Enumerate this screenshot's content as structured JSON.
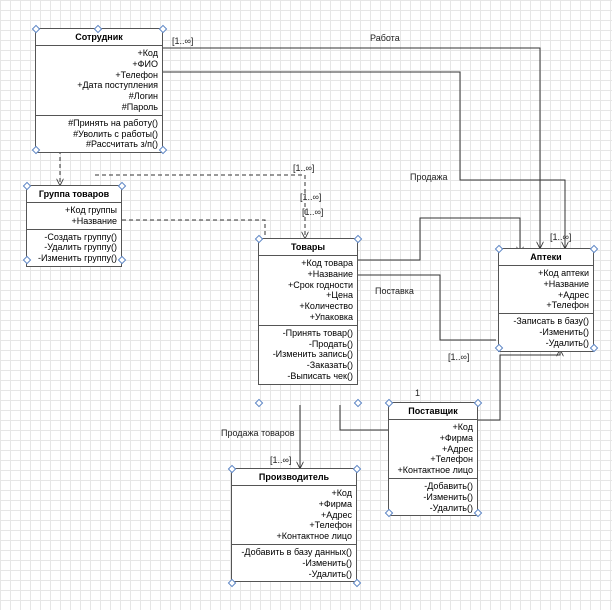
{
  "classes": {
    "employee": {
      "title": "Сотрудник",
      "attrs": [
        "+Код",
        "+ФИО",
        "+Телефон",
        "+Дата поступления",
        "#Логин",
        "#Пароль"
      ],
      "ops": [
        "#Принять на работу()",
        "#Уволить с работы()",
        "#Рассчитать з/п()"
      ]
    },
    "product_group": {
      "title": "Группа товаров",
      "attrs": [
        "+Код группы",
        "+Название"
      ],
      "ops": [
        "-Создать группу()",
        "-Удалить группу()",
        "-Изменить группу()"
      ]
    },
    "goods": {
      "title": "Товары",
      "attrs": [
        "+Код товара",
        "+Название",
        "+Срок годности",
        "+Цена",
        "+Количество",
        "+Упаковка"
      ],
      "ops": [
        "-Принять товар()",
        "-Продать()",
        "-Изменить запись()",
        "-Заказать()",
        "-Выписать чек()"
      ]
    },
    "pharmacies": {
      "title": "Аптеки",
      "attrs": [
        "+Код аптеки",
        "+Название",
        "+Адрес",
        "+Телефон"
      ],
      "ops": [
        "-Записать в базу()",
        "-Изменить()",
        "-Удалить()"
      ]
    },
    "supplier": {
      "title": "Поставщик",
      "attrs": [
        "+Код",
        "+Фирма",
        "+Адрес",
        "+Телефон",
        "+Контактное лицо"
      ],
      "ops": [
        "-Добавить()",
        "-Изменить()",
        "-Удалить()"
      ]
    },
    "manufacturer": {
      "title": "Производитель",
      "attrs": [
        "+Код",
        "+Фирма",
        "+Адрес",
        "+Телефон",
        "+Контактное лицо"
      ],
      "ops": [
        "-Добавить в базу данных()",
        "-Изменить()",
        "-Удалить()"
      ]
    }
  },
  "associations": {
    "work": {
      "label": "Работа",
      "m1": "[1..∞]",
      "m2": "[1..∞]"
    },
    "sale": {
      "label": "Продажа",
      "m1": "[1..∞]",
      "m2": "[1..∞]"
    },
    "delivery": {
      "label": "Поставка",
      "m2": "[1..∞]"
    },
    "supplier_one": {
      "m": "1"
    },
    "goods_sale": {
      "label": "Продажа товаров",
      "m": "[1..∞]"
    },
    "group_goods": {
      "m": "[1..∞]"
    }
  },
  "chart_data": {
    "type": "uml-class-diagram",
    "classes": [
      {
        "name": "Сотрудник",
        "attributes": [
          "+Код",
          "+ФИО",
          "+Телефон",
          "+Дата поступления",
          "#Логин",
          "#Пароль"
        ],
        "operations": [
          "#Принять на работу()",
          "#Уволить с работы()",
          "#Рассчитать з/п()"
        ]
      },
      {
        "name": "Группа товаров",
        "attributes": [
          "+Код группы",
          "+Название"
        ],
        "operations": [
          "-Создать группу()",
          "-Удалить группу()",
          "-Изменить группу()"
        ]
      },
      {
        "name": "Товары",
        "attributes": [
          "+Код товара",
          "+Название",
          "+Срок годности",
          "+Цена",
          "+Количество",
          "+Упаковка"
        ],
        "operations": [
          "-Принять товар()",
          "-Продать()",
          "-Изменить запись()",
          "-Заказать()",
          "-Выписать чек()"
        ]
      },
      {
        "name": "Аптеки",
        "attributes": [
          "+Код аптеки",
          "+Название",
          "+Адрес",
          "+Телефон"
        ],
        "operations": [
          "-Записать в базу()",
          "-Изменить()",
          "-Удалить()"
        ]
      },
      {
        "name": "Поставщик",
        "attributes": [
          "+Код",
          "+Фирма",
          "+Адрес",
          "+Телефон",
          "+Контактное лицо"
        ],
        "operations": [
          "-Добавить()",
          "-Изменить()",
          "-Удалить()"
        ]
      },
      {
        "name": "Производитель",
        "attributes": [
          "+Код",
          "+Фирма",
          "+Адрес",
          "+Телефон",
          "+Контактное лицо"
        ],
        "operations": [
          "-Добавить в базу данных()",
          "-Изменить()",
          "-Удалить()"
        ]
      }
    ],
    "associations": [
      {
        "from": "Сотрудник",
        "to": "Аптеки",
        "label": "Работа",
        "multiplicity_from": "1..∞",
        "multiplicity_to": "1..∞",
        "navigable": "to"
      },
      {
        "from": "Сотрудник",
        "to": "Товары",
        "label": "Продажа",
        "multiplicity_from": "1..∞",
        "multiplicity_to": "1..∞",
        "navigable": "to"
      },
      {
        "from": "Сотрудник",
        "to": "Группа товаров",
        "style": "dashed",
        "navigable": "to"
      },
      {
        "from": "Группа товаров",
        "to": "Товары",
        "style": "dashed",
        "multiplicity_to": "1..∞",
        "navigable": "to"
      },
      {
        "from": "Товары",
        "to": "Аптеки",
        "label": "Поставка",
        "multiplicity_to": "1..∞",
        "navigable": "to"
      },
      {
        "from": "Товары",
        "to": "Поставщик",
        "multiplicity_to": "1",
        "navigable": "to"
      },
      {
        "from": "Товары",
        "to": "Производитель",
        "label": "Продажа товаров",
        "multiplicity_to": "1..∞",
        "navigable": "to"
      },
      {
        "from": "Поставщик",
        "to": "Аптеки",
        "navigable": "to"
      }
    ]
  }
}
